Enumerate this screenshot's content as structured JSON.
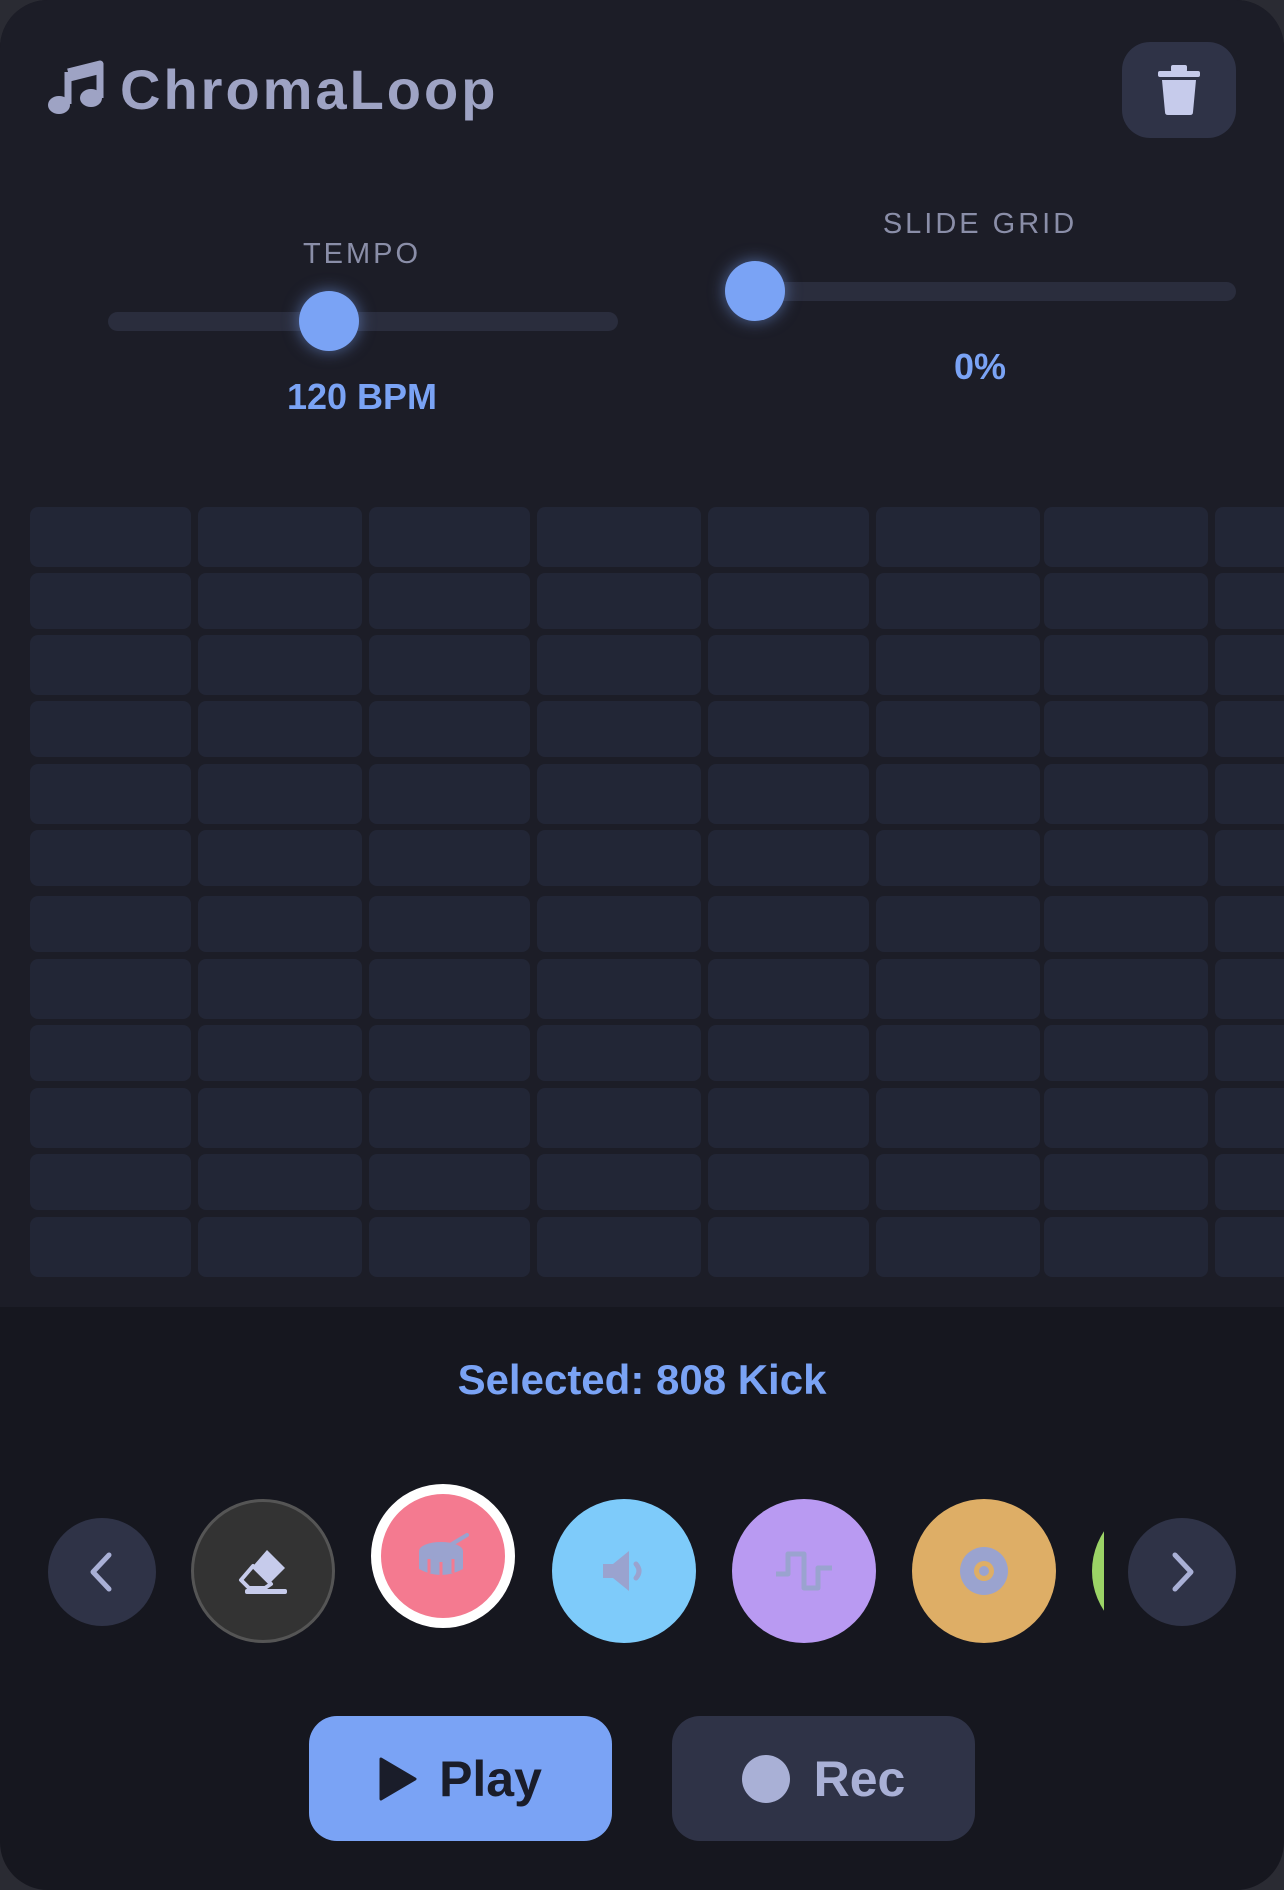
{
  "app": {
    "title": "ChromaLoop"
  },
  "tempo": {
    "label": "TEMPO",
    "value_text": "120 BPM",
    "level": 0.43
  },
  "slide_grid": {
    "label": "SLIDE GRID",
    "value_text": "0%",
    "level": 0.0
  },
  "grid": {
    "rows": 12,
    "columns_visible": 8
  },
  "selection": {
    "text": "Selected: 808 Kick"
  },
  "instruments": [
    {
      "id": "eraser",
      "icon": "eraser-icon",
      "color": "#333333"
    },
    {
      "id": "808-kick",
      "icon": "drum-icon",
      "color": "#f47a90",
      "selected": true
    },
    {
      "id": "speaker",
      "icon": "speaker-icon",
      "color": "#7ecbfa"
    },
    {
      "id": "wave",
      "icon": "wave-icon",
      "color": "#b99af2"
    },
    {
      "id": "disc",
      "icon": "disc-icon",
      "color": "#deae66"
    },
    {
      "id": "partial",
      "icon": "",
      "color": "#9bd366"
    }
  ],
  "transport": {
    "play_label": "Play",
    "rec_label": "Rec"
  },
  "colors": {
    "accent": "#7aa3f5",
    "background": "#16171f",
    "panel": "#1c1d27"
  }
}
